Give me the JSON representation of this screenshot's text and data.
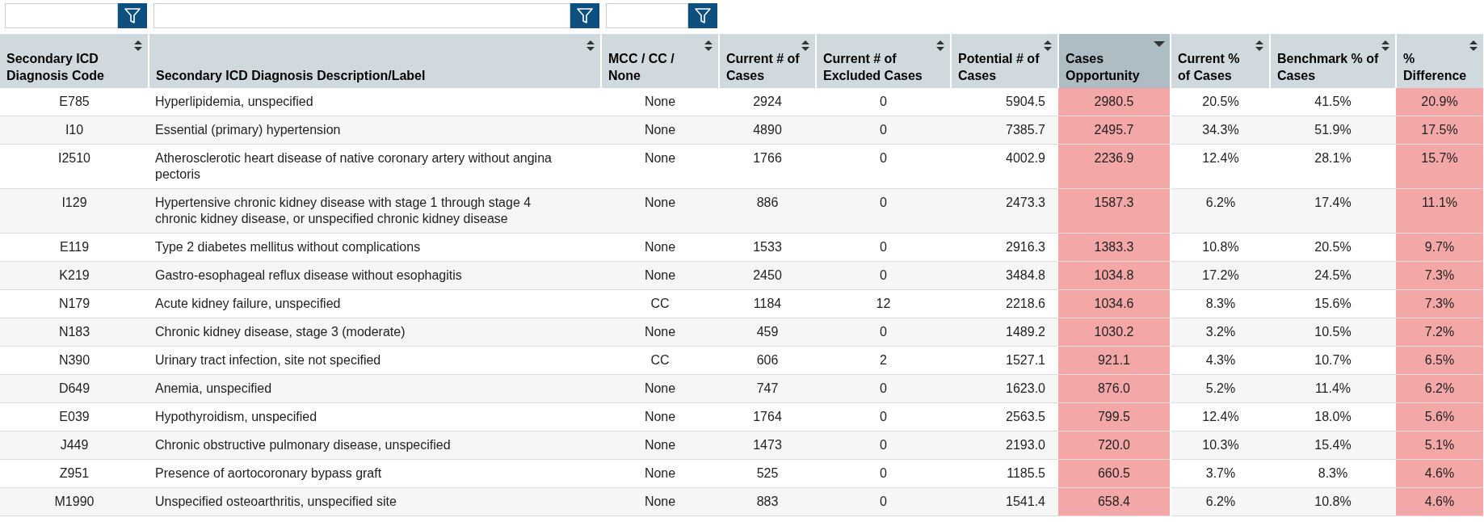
{
  "table": {
    "columns": [
      {
        "label": "Secondary ICD Diagnosis Code",
        "sorted": false,
        "highlight": false
      },
      {
        "label": "Secondary ICD Diagnosis Description/Label",
        "sorted": false,
        "highlight": false
      },
      {
        "label": "MCC / CC / None",
        "sorted": false,
        "highlight": false
      },
      {
        "label": "Current # of Cases",
        "sorted": false,
        "highlight": false
      },
      {
        "label": "Current # of Excluded Cases",
        "sorted": false,
        "highlight": false
      },
      {
        "label": "Potential # of Cases",
        "sorted": false,
        "highlight": false
      },
      {
        "label": "Cases Opportunity",
        "sorted": true,
        "highlight": true
      },
      {
        "label": "Current % of Cases",
        "sorted": false,
        "highlight": false
      },
      {
        "label": "Benchmark % of Cases",
        "sorted": false,
        "highlight": false
      },
      {
        "label": "% Difference",
        "sorted": false,
        "highlight": true
      }
    ],
    "rows": [
      [
        "E785",
        "Hyperlipidemia, unspecified",
        "None",
        "2924",
        "0",
        "5904.5",
        "2980.5",
        "20.5%",
        "41.5%",
        "20.9%"
      ],
      [
        "I10",
        "Essential (primary) hypertension",
        "None",
        "4890",
        "0",
        "7385.7",
        "2495.7",
        "34.3%",
        "51.9%",
        "17.5%"
      ],
      [
        "I2510",
        "Atherosclerotic heart disease of native coronary artery without angina pectoris",
        "None",
        "1766",
        "0",
        "4002.9",
        "2236.9",
        "12.4%",
        "28.1%",
        "15.7%"
      ],
      [
        "I129",
        "Hypertensive chronic kidney disease with stage 1 through stage 4 chronic kidney disease, or unspecified chronic kidney disease",
        "None",
        "886",
        "0",
        "2473.3",
        "1587.3",
        "6.2%",
        "17.4%",
        "11.1%"
      ],
      [
        "E119",
        "Type 2 diabetes mellitus without complications",
        "None",
        "1533",
        "0",
        "2916.3",
        "1383.3",
        "10.8%",
        "20.5%",
        "9.7%"
      ],
      [
        "K219",
        "Gastro-esophageal reflux disease without esophagitis",
        "None",
        "2450",
        "0",
        "3484.8",
        "1034.8",
        "17.2%",
        "24.5%",
        "7.3%"
      ],
      [
        "N179",
        "Acute kidney failure, unspecified",
        "CC",
        "1184",
        "12",
        "2218.6",
        "1034.6",
        "8.3%",
        "15.6%",
        "7.3%"
      ],
      [
        "N183",
        "Chronic kidney disease, stage 3 (moderate)",
        "None",
        "459",
        "0",
        "1489.2",
        "1030.2",
        "3.2%",
        "10.5%",
        "7.2%"
      ],
      [
        "N390",
        "Urinary tract infection, site not specified",
        "CC",
        "606",
        "2",
        "1527.1",
        "921.1",
        "4.3%",
        "10.7%",
        "6.5%"
      ],
      [
        "D649",
        "Anemia, unspecified",
        "None",
        "747",
        "0",
        "1623.0",
        "876.0",
        "5.2%",
        "11.4%",
        "6.2%"
      ],
      [
        "E039",
        "Hypothyroidism, unspecified",
        "None",
        "1764",
        "0",
        "2563.5",
        "799.5",
        "12.4%",
        "18.0%",
        "5.6%"
      ],
      [
        "J449",
        "Chronic obstructive pulmonary disease, unspecified",
        "None",
        "1473",
        "0",
        "2193.0",
        "720.0",
        "10.3%",
        "15.4%",
        "5.1%"
      ],
      [
        "Z951",
        "Presence of aortocoronary bypass graft",
        "None",
        "525",
        "0",
        "1185.5",
        "660.5",
        "3.7%",
        "8.3%",
        "4.6%"
      ],
      [
        "M1990",
        "Unspecified osteoarthritis, unspecified site",
        "None",
        "883",
        "0",
        "1541.4",
        "658.4",
        "6.2%",
        "10.8%",
        "4.6%"
      ]
    ]
  }
}
